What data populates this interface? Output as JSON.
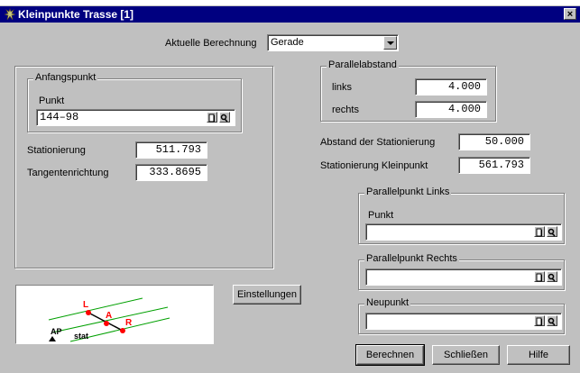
{
  "window": {
    "title": "Kleinpunkte Trasse [1]",
    "close_glyph": "×"
  },
  "berechnung": {
    "label": "Aktuelle Berechnung",
    "value": "Gerade"
  },
  "anfangspunkt": {
    "group_title": "Anfangspunkt",
    "punkt_label": "Punkt",
    "punkt_value": "144–98"
  },
  "stationierung": {
    "label": "Stationierung",
    "value": "511.793"
  },
  "tangentenrichtung": {
    "label": "Tangentenrichtung",
    "value": "333.8695"
  },
  "parallelabstand": {
    "group_title": "Parallelabstand",
    "links_label": "links",
    "links_value": "4.000",
    "rechts_label": "rechts",
    "rechts_value": "4.000"
  },
  "abstand": {
    "label": "Abstand der Stationierung",
    "value": "50.000"
  },
  "stationierung_kleinpunkt": {
    "label": "Stationierung Kleinpunkt",
    "value": "561.793"
  },
  "parallelpunkt_links": {
    "group_title": "Parallelpunkt Links",
    "punkt_label": "Punkt",
    "value": ""
  },
  "parallelpunkt_rechts": {
    "group_title": "Parallelpunkt Rechts",
    "value": ""
  },
  "neupunkt": {
    "group_title": "Neupunkt",
    "value": ""
  },
  "buttons": {
    "einstellungen": "Einstellungen",
    "berechnen": "Berechnen",
    "schliessen": "Schließen",
    "hilfe": "Hilfe"
  },
  "diagram": {
    "label_l": "L",
    "label_a": "A",
    "label_r": "R",
    "label_ap": "AP",
    "label_stat": "stat"
  },
  "colors": {
    "titlebar": "#000080",
    "dialog": "#c0c0c0",
    "diagram_lines": "#00a000",
    "diagram_points": "#ff0000"
  },
  "icons": {
    "title": "app-icon",
    "browse": "file-browse-icon",
    "pick": "point-pick-icon"
  }
}
